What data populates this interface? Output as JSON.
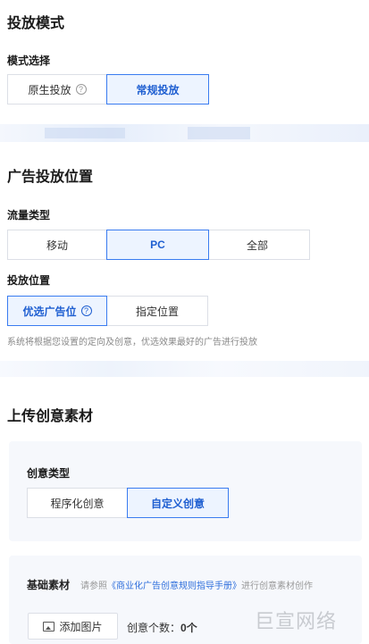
{
  "section1": {
    "title": "投放模式",
    "mode_label": "模式选择",
    "mode_options": [
      {
        "label": "原生投放",
        "help": "?"
      },
      {
        "label": "常规投放",
        "active": true
      }
    ]
  },
  "section2": {
    "title": "广告投放位置",
    "traffic_label": "流量类型",
    "traffic_options": [
      {
        "label": "移动"
      },
      {
        "label": "PC",
        "active": true
      },
      {
        "label": "全部"
      }
    ],
    "placement_label": "投放位置",
    "placement_options": [
      {
        "label": "优选广告位",
        "help": "?",
        "active": true
      },
      {
        "label": "指定位置"
      }
    ],
    "hint": "系统将根据您设置的定向及创意，优选效果最好的广告进行投放"
  },
  "section3": {
    "title": "上传创意素材",
    "creative_type_label": "创意类型",
    "creative_options": [
      {
        "label": "程序化创意"
      },
      {
        "label": "自定义创意",
        "active": true
      }
    ],
    "material": {
      "title": "基础素材",
      "tip_prefix": "请参照",
      "tip_link": "《商业化广告创意规则指导手册》",
      "tip_suffix": "进行创意素材创作",
      "add_image": "添加图片",
      "count_label": "创意个数：",
      "count_value": "0个"
    }
  },
  "watermark": "巨宣网络",
  "colors": {
    "accent": "#3a7cf0",
    "active_bg": "#edf4ff",
    "link": "#2f6fdc"
  }
}
